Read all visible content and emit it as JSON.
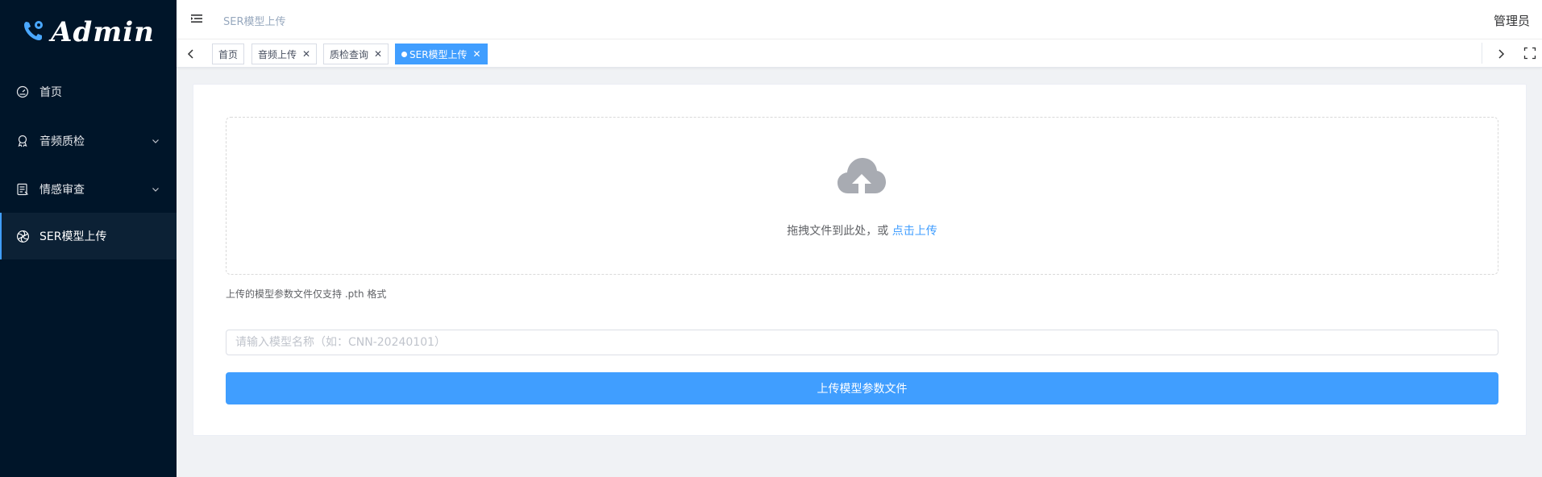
{
  "app": {
    "logo_text": "Admin"
  },
  "sidebar": {
    "items": [
      {
        "label": "首页",
        "icon": "dashboard-icon",
        "has_submenu": false
      },
      {
        "label": "音频质检",
        "icon": "award-icon",
        "has_submenu": true
      },
      {
        "label": "情感审查",
        "icon": "document-icon",
        "has_submenu": true
      },
      {
        "label": "SER模型上传",
        "icon": "openai-icon",
        "has_submenu": false,
        "active": true
      }
    ]
  },
  "header": {
    "breadcrumb": "SER模型上传",
    "user_name": "管理员"
  },
  "tags": [
    {
      "label": "首页",
      "closable": false
    },
    {
      "label": "音频上传",
      "closable": true
    },
    {
      "label": "质检查询",
      "closable": true
    },
    {
      "label": "SER模型上传",
      "closable": true,
      "active": true
    }
  ],
  "upload": {
    "drop_text": "拖拽文件到此处，或",
    "click_link": "点击上传",
    "tip": "上传的模型参数文件仅支持 .pth 格式",
    "name_placeholder": "请输入模型名称（如：CNN-20240101）",
    "name_value": "",
    "submit_label": "上传模型参数文件"
  },
  "colors": {
    "sidebar_bg": "#001529",
    "primary": "#409eff",
    "page_bg": "#f0f2f5"
  }
}
